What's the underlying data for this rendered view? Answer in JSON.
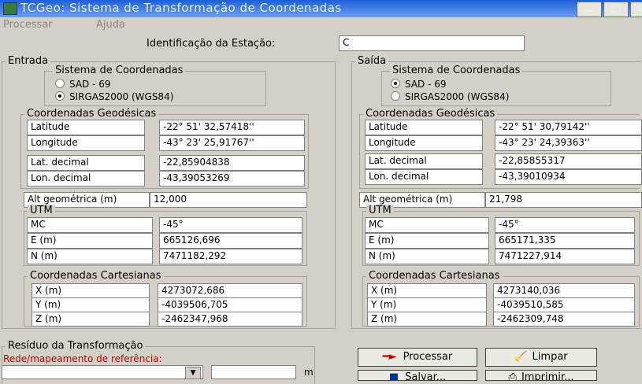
{
  "window": {
    "title": "TCGeo: Sistema de Transformação de Coordenadas",
    "controls": {
      "minimize": "▁",
      "maximize": "□",
      "close": "≤"
    }
  },
  "menu": {
    "items": [
      "Processar",
      "Ajuda"
    ]
  },
  "identificacao": {
    "label": "Identificação da Estação:",
    "value": "C"
  },
  "entrada": {
    "title": "Entrada",
    "sistema": {
      "title": "Sistema de Coordenadas",
      "options": [
        "SAD - 69",
        "SIRGAS2000 (WGS84)"
      ],
      "selected": 1
    },
    "geodesicas": {
      "title": "Coordenadas Geodésicas",
      "latitude": {
        "label": "Latitude",
        "value": "-22° 51' 32,57418''"
      },
      "longitude": {
        "label": "Longitude",
        "value": "-43° 23' 25,91767''"
      },
      "lat_decimal": {
        "label": "Lat. decimal",
        "value": "-22,85904838"
      },
      "lon_decimal": {
        "label": "Lon. decimal",
        "value": "-43,39053269"
      }
    },
    "alt": {
      "label": "Alt geométrica (m)",
      "value": "12,000"
    },
    "utm": {
      "title": "UTM",
      "mc": {
        "label": "MC",
        "value": "-45°"
      },
      "e": {
        "label": "E (m)",
        "value": "665126,696"
      },
      "n": {
        "label": "N (m)",
        "value": "7471182,292"
      }
    },
    "cartesianas": {
      "title": "Coordenadas Cartesianas",
      "x": {
        "label": "X (m)",
        "value": "4273072,686"
      },
      "y": {
        "label": "Y (m)",
        "value": "-4039506,705"
      },
      "z": {
        "label": "Z (m)",
        "value": "-2462347,968"
      }
    }
  },
  "saida": {
    "title": "Saída",
    "sistema": {
      "title": "Sistema de Coordenadas",
      "options": [
        "SAD - 69",
        "SIRGAS2000 (WGS84)"
      ],
      "selected": 0
    },
    "geodesicas": {
      "title": "Coordenadas Geodésicas",
      "latitude": {
        "label": "Latitude",
        "value": "-22° 51' 30,79142''"
      },
      "longitude": {
        "label": "Longitude",
        "value": "-43° 23' 24,39363''"
      },
      "lat_decimal": {
        "label": "Lat. decimal",
        "value": "-22,85855317"
      },
      "lon_decimal": {
        "label": "Lon. decimal",
        "value": "-43,39010934"
      }
    },
    "alt": {
      "label": "Alt geométrica (m)",
      "value": "21,798"
    },
    "utm": {
      "title": "UTM",
      "mc": {
        "label": "MC",
        "value": "-45°"
      },
      "e": {
        "label": "E (m)",
        "value": "665171,335"
      },
      "n": {
        "label": "N (m)",
        "value": "7471227,914"
      }
    },
    "cartesianas": {
      "title": "Coordenadas Cartesianas",
      "x": {
        "label": "X (m)",
        "value": "4273140,036"
      },
      "y": {
        "label": "Y (m)",
        "value": "-4039510,585"
      },
      "z": {
        "label": "Z (m)",
        "value": "-2462309,748"
      }
    }
  },
  "residuo": {
    "title": "Resíduo da Transformação",
    "rede_label": "Rede/mapeamento de referência:",
    "unit": "m",
    "value": ""
  },
  "buttons": {
    "processar": "Processar",
    "limpar": "Limpar",
    "salvar": "Salvar...",
    "imprimir": "Imprimir..."
  },
  "colors": {
    "accent_red": "#c00000",
    "titlebar": "#1c5fd6"
  }
}
